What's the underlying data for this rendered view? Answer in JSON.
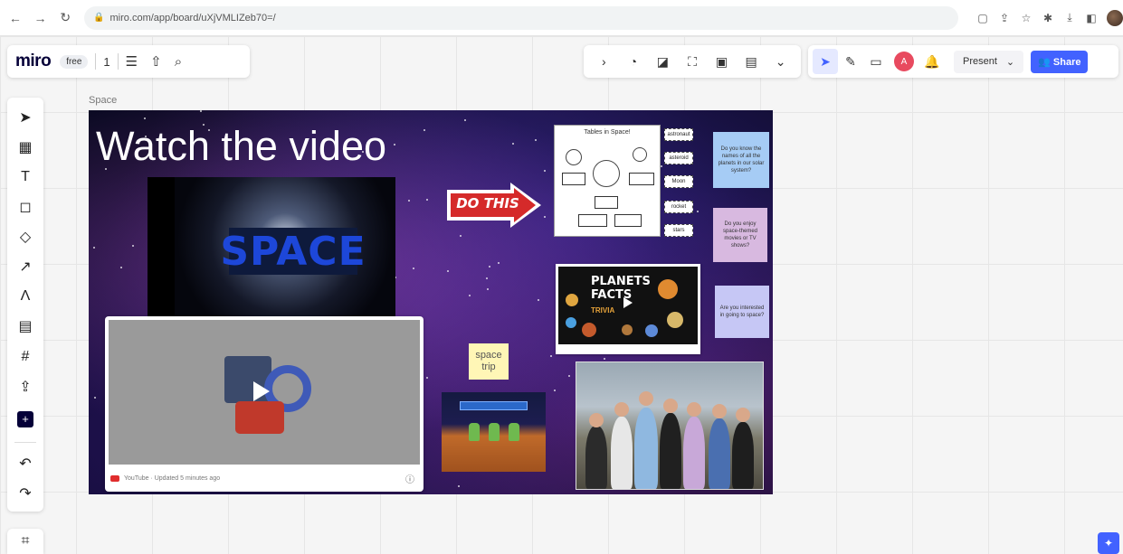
{
  "browser": {
    "url": "miro.com/app/board/uXjVMLIZeb70=/"
  },
  "miro_header": {
    "logo": "miro",
    "plan_badge": "free",
    "board_count": "1"
  },
  "toolbar_right": {
    "avatar_initial": "A",
    "present_label": "Present",
    "share_label": "Share"
  },
  "board": {
    "frame_label": "Space",
    "title": "Watch the video",
    "space_video_text": "SPACE",
    "do_this_label": "DO THIS",
    "worksheet_title": "Tables in Space!",
    "word_tags": [
      "astronaut",
      "asteroid",
      "Moon",
      "rocket",
      "stars"
    ],
    "stickies": {
      "planets_question": "Do you know the names of all the planets in our solar system?",
      "movies_question": "Do you enjoy space-themed movies or TV shows?",
      "interest_question": "Are you interested in going to space?",
      "trip_note": "space trip"
    },
    "planets_card": {
      "line1": "PLANETS",
      "line2": "FACTS",
      "trivia": "TRIVIA"
    },
    "youtube_footer": "YouTube · Updated 5 minutes ago"
  },
  "colors": {
    "accent": "#4262ff",
    "miro_dark": "#050038",
    "do_this_red": "#d52a2a"
  },
  "icons": {
    "left_toolbar": [
      "select-icon",
      "templates-icon",
      "text-icon",
      "sticky-note-icon",
      "shapes-icon",
      "connection-line-icon",
      "pen-icon",
      "comment-icon",
      "frame-icon",
      "upload-icon",
      "add-more-icon",
      "undo-icon",
      "redo-icon"
    ]
  }
}
